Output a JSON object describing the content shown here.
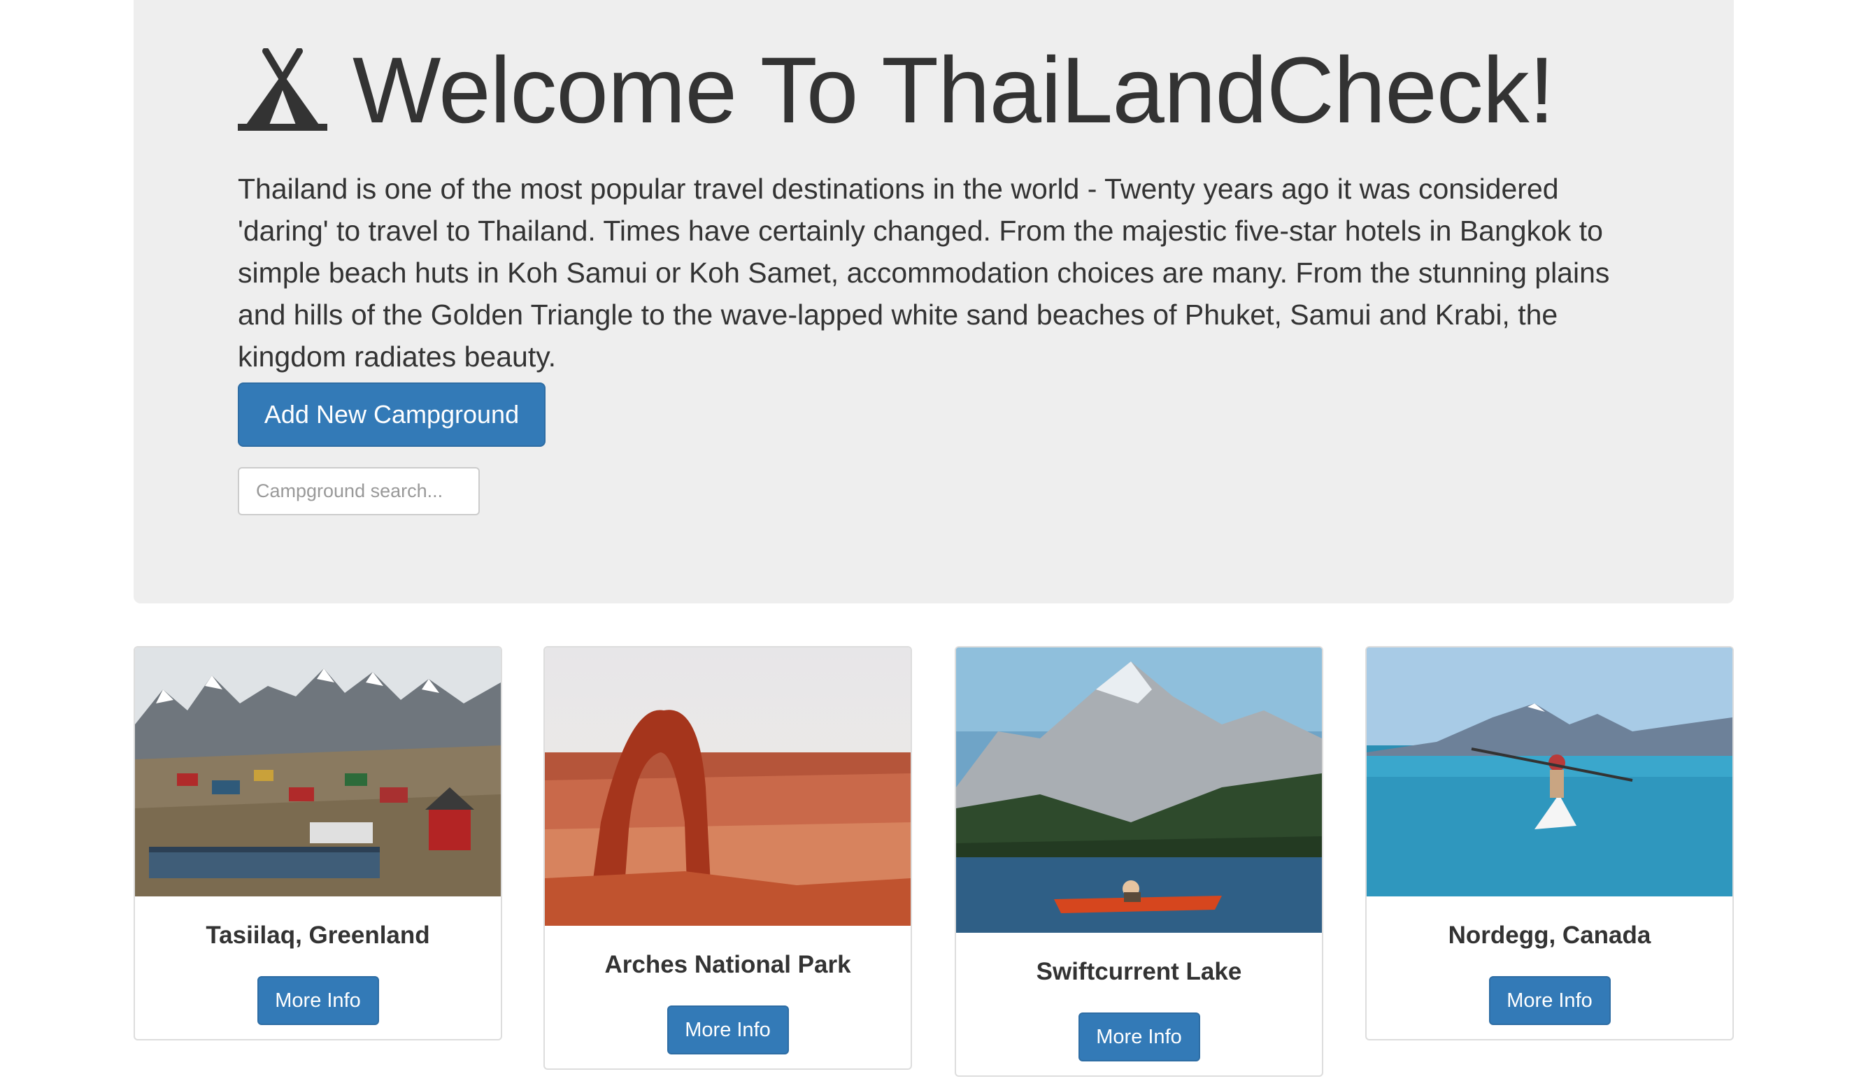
{
  "jumbotron": {
    "title": "Welcome To ThaiLandCheck!",
    "icon": "tent-icon",
    "intro": "Thailand is one of the most popular travel destinations in the world - Twenty years ago it was considered 'daring' to travel to Thailand. Times have certainly changed. From the majestic five-star hotels in Bangkok to simple beach huts in Koh Samui or Koh Samet, accommodation choices are many. From the stunning plains and hills of the Golden Triangle to the wave-lapped white sand beaches of Phuket, Samui and Krabi, the kingdom radiates beauty.",
    "add_button_label": "Add New Campground",
    "search_placeholder": "Campground search..."
  },
  "campgrounds": [
    {
      "name": "Tasiilaq, Greenland",
      "button_label": "More Info",
      "image": "greenland-town-photo"
    },
    {
      "name": "Arches National Park",
      "button_label": "More Info",
      "image": "red-rock-arch-photo"
    },
    {
      "name": "Swiftcurrent Lake",
      "button_label": "More Info",
      "image": "mountain-lake-kayak-photo"
    },
    {
      "name": "Nordegg, Canada",
      "button_label": "More Info",
      "image": "kayaker-lake-photo"
    }
  ],
  "colors": {
    "primary": "#337ab7",
    "jumbotron_bg": "#eeeeee",
    "text": "#333333"
  }
}
